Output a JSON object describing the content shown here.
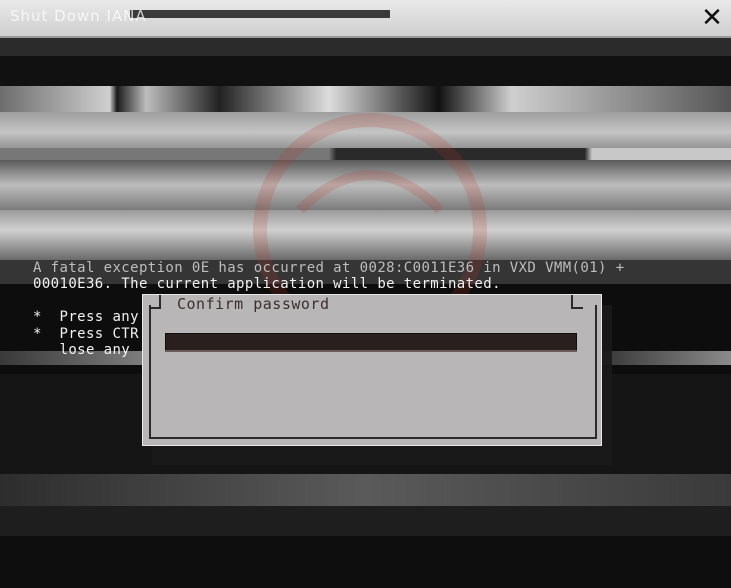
{
  "window": {
    "title": "Shut Down IANA"
  },
  "bsod": {
    "line1": "A fatal exception 0E has occurred at 0028:C0011E36 in VXD VMM(01) +",
    "line2": "00010E36. The current application will be terminated.",
    "bullet1": "*  Press any",
    "bullet2": "*  Press CTR",
    "bullet3": "   lose any"
  },
  "dialog": {
    "title": "Confirm password",
    "password_value": "",
    "password_placeholder": ""
  },
  "icons": {
    "close": "close-icon",
    "watermark": "iana-logo-watermark"
  },
  "colors": {
    "dialog_bg": "#b8b6b6",
    "field_bg": "#2a1f1f",
    "watermark": "#c0392b"
  }
}
